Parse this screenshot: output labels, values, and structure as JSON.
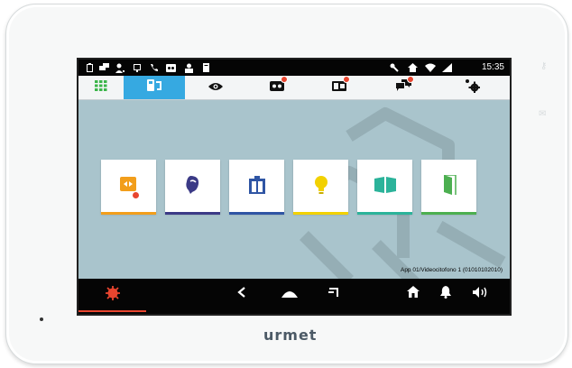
{
  "device": {
    "brand": "urmet"
  },
  "status_bar": {
    "time": "15:35",
    "left_icons": [
      "clipboard-icon",
      "chat-icon",
      "user-icon",
      "monitor-icon",
      "phone-icon",
      "voicemail-icon",
      "contact-icon",
      "document-icon"
    ],
    "right_icons": [
      "wrench-icon",
      "home-icon",
      "wifi-icon",
      "signal-icon"
    ]
  },
  "tabs": [
    {
      "name": "apps-grid",
      "icon": "grid-icon",
      "active": false
    },
    {
      "name": "intercom",
      "icon": "intercom-icon",
      "active": true
    },
    {
      "name": "camera-view",
      "icon": "eye-icon",
      "active": false
    },
    {
      "name": "voicemail",
      "icon": "voicemail-icon",
      "active": false,
      "badge": true
    },
    {
      "name": "video-memo",
      "icon": "video-memo-icon",
      "active": false,
      "badge": true
    },
    {
      "name": "messages",
      "icon": "chat-icon",
      "active": false,
      "badge": true
    },
    {
      "name": "settings",
      "icon": "gear-icon",
      "active": false
    }
  ],
  "tiles": [
    {
      "name": "alarm-panel",
      "icon": "panel-alarm-icon",
      "color": "#f29e1b",
      "bar": "#f29e1b"
    },
    {
      "name": "concierge",
      "icon": "headset-icon",
      "color": "#3b3a86",
      "bar": "#3b3a86"
    },
    {
      "name": "elevator",
      "icon": "elevator-icon",
      "color": "#2f55a4",
      "bar": "#2f55a4"
    },
    {
      "name": "lights",
      "icon": "lightbulb-icon",
      "color": "#f2d100",
      "bar": "#f2d100"
    },
    {
      "name": "gate",
      "icon": "gate-icon",
      "color": "#2bb39a",
      "bar": "#2bb39a"
    },
    {
      "name": "door",
      "icon": "door-icon",
      "color": "#4caf50",
      "bar": "#4caf50"
    }
  ],
  "footer_text": "App 01/Videocitofono 1 (01010102010)",
  "nav": {
    "alarm_color": "#e8452f",
    "buttons": [
      "alarm-icon",
      "back-icon",
      "home-nav-icon",
      "recent-apps-icon",
      "home-icon",
      "bell-icon",
      "volume-icon"
    ]
  }
}
